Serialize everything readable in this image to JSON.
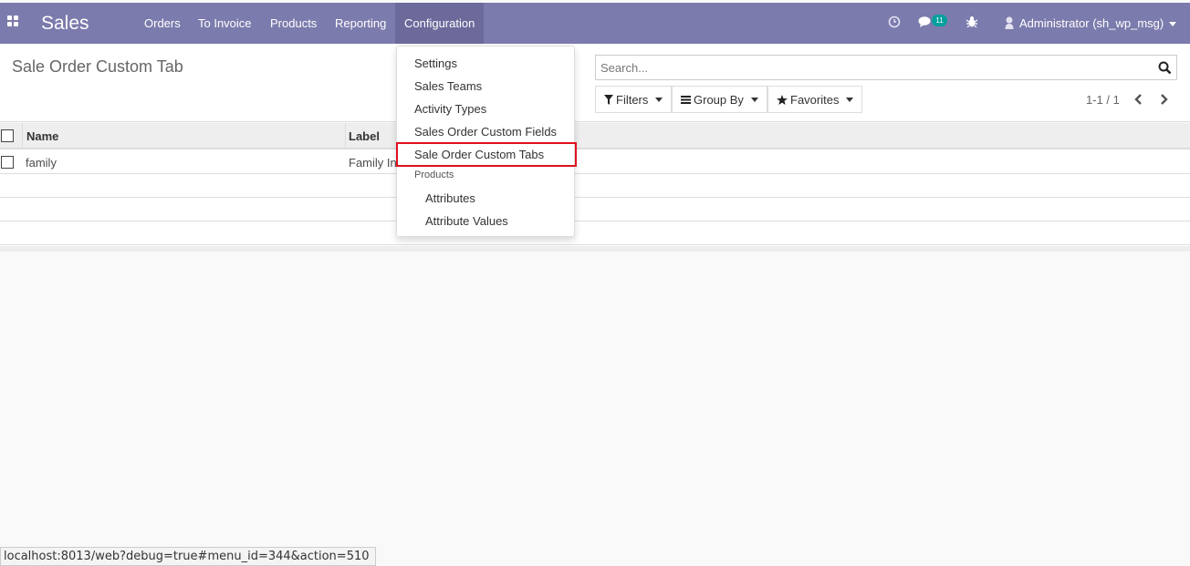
{
  "navbar": {
    "app_title": "Sales",
    "menus": [
      "Orders",
      "To Invoice",
      "Products",
      "Reporting",
      "Configuration"
    ],
    "messages_count": "11",
    "user_name": "Administrator (sh_wp_msg)",
    "bar_color": "#7c7bad"
  },
  "control_panel": {
    "title": "Sale Order Custom Tab",
    "search_placeholder": "Search...",
    "filters_label": "Filters",
    "group_by_label": "Group By",
    "favorites_label": "Favorites",
    "pager": "1-1 / 1"
  },
  "list": {
    "columns": [
      "Name",
      "Label"
    ],
    "rows": [
      {
        "name": "family",
        "label": "Family In"
      }
    ]
  },
  "config_dropdown": {
    "items": [
      "Settings",
      "Sales Teams",
      "Activity Types",
      "Sales Order Custom Fields",
      "Sale Order Custom Tabs"
    ],
    "highlighted": "Sale Order Custom Tabs",
    "highlight_color": "#e0101f",
    "section_header": "Products",
    "sub_items": [
      "Attributes",
      "Attribute Values"
    ]
  },
  "status_url": "localhost:8013/web?debug=true#menu_id=344&action=510"
}
